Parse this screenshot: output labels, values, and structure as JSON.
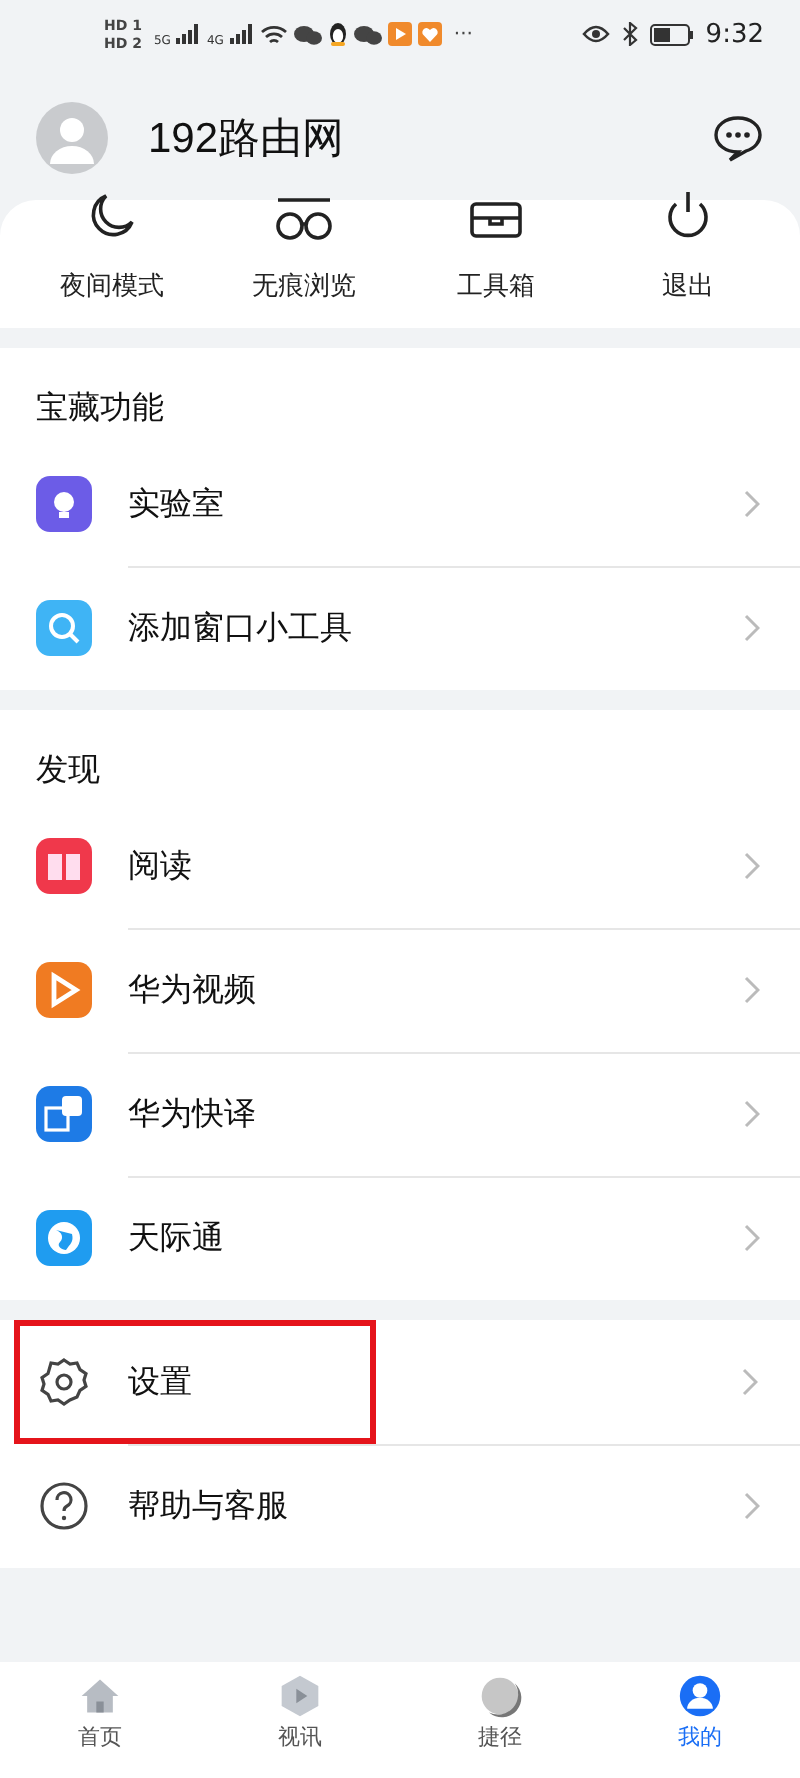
{
  "status_bar": {
    "sim_labels": [
      "HD 1",
      "HD 2"
    ],
    "network_labels": [
      "5G",
      "4G"
    ],
    "more": "···",
    "time": "9:32"
  },
  "profile": {
    "name": "192路由网"
  },
  "quick_actions": [
    {
      "kind": "moon",
      "label": "夜间模式"
    },
    {
      "kind": "glasses",
      "label": "无痕浏览"
    },
    {
      "kind": "toolbox",
      "label": "工具箱"
    },
    {
      "kind": "power",
      "label": "退出"
    }
  ],
  "sections": [
    {
      "title": "宝藏功能",
      "items": [
        {
          "kind": "lab",
          "label": "实验室",
          "highlighted": false
        },
        {
          "kind": "widget",
          "label": "添加窗口小工具",
          "highlighted": false
        }
      ]
    },
    {
      "title": "发现",
      "items": [
        {
          "kind": "read",
          "label": "阅读",
          "highlighted": false
        },
        {
          "kind": "video",
          "label": "华为视频",
          "highlighted": false
        },
        {
          "kind": "translate",
          "label": "华为快译",
          "highlighted": false
        },
        {
          "kind": "globe",
          "label": "天际通",
          "highlighted": false
        }
      ]
    },
    {
      "items": [
        {
          "kind": "settings",
          "label": "设置",
          "highlighted": true
        },
        {
          "kind": "help",
          "label": "帮助与客服",
          "highlighted": false
        }
      ]
    }
  ],
  "bottom_nav": [
    {
      "kind": "home",
      "label": "首页",
      "selected": false
    },
    {
      "kind": "video",
      "label": "视讯",
      "selected": false
    },
    {
      "kind": "shortcut",
      "label": "捷径",
      "selected": false
    },
    {
      "kind": "me",
      "label": "我的",
      "selected": true
    }
  ]
}
